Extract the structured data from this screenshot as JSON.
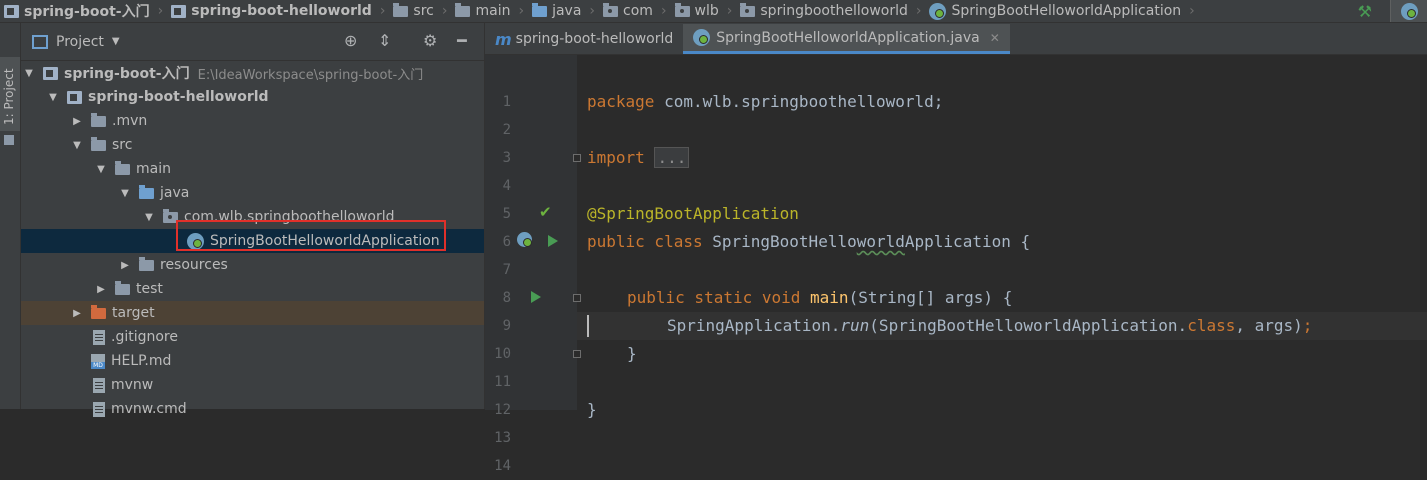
{
  "breadcrumbs": [
    "spring-boot-入门",
    "spring-boot-helloworld",
    "src",
    "main",
    "java",
    "com",
    "wlb",
    "springboothelloworld",
    "SpringBootHelloworldApplication"
  ],
  "side_tab": "1: Project",
  "project_panel": {
    "title": "Project",
    "tree": [
      {
        "label": "spring-boot-入门",
        "path": "E:\\IdeaWorkspace\\spring-boot-入门",
        "indent": 0,
        "state": "open",
        "icon": "module-icon",
        "bold": true
      },
      {
        "label": "spring-boot-helloworld",
        "path": "",
        "indent": 1,
        "state": "open",
        "icon": "module-icon",
        "bold": true
      },
      {
        "label": ".mvn",
        "path": "",
        "indent": 2,
        "state": "closed",
        "icon": "folder-icon"
      },
      {
        "label": "src",
        "path": "",
        "indent": 2,
        "state": "open",
        "icon": "folder-icon"
      },
      {
        "label": "main",
        "path": "",
        "indent": 3,
        "state": "open",
        "icon": "folder-icon"
      },
      {
        "label": "java",
        "path": "",
        "indent": 4,
        "state": "open",
        "icon": "source-folder-icon"
      },
      {
        "label": "com.wlb.springboothelloworld",
        "path": "",
        "indent": 5,
        "state": "open",
        "icon": "package-icon"
      },
      {
        "label": "SpringBootHelloworldApplication",
        "path": "",
        "indent": 6,
        "state": "none",
        "icon": "spring-class-icon",
        "selected": true
      },
      {
        "label": "resources",
        "path": "",
        "indent": 4,
        "state": "closed",
        "icon": "resources-folder-icon"
      },
      {
        "label": "test",
        "path": "",
        "indent": 3,
        "state": "closed",
        "icon": "folder-icon"
      },
      {
        "label": "target",
        "path": "",
        "indent": 2,
        "state": "closed",
        "icon": "excluded-folder-icon",
        "excluded": true
      },
      {
        "label": ".gitignore",
        "path": "",
        "indent": 2,
        "state": "none",
        "icon": "file-icon"
      },
      {
        "label": "HELP.md",
        "path": "",
        "indent": 2,
        "state": "none",
        "icon": "markdown-file-icon"
      },
      {
        "label": "mvnw",
        "path": "",
        "indent": 2,
        "state": "none",
        "icon": "file-icon"
      },
      {
        "label": "mvnw.cmd",
        "path": "",
        "indent": 2,
        "state": "none",
        "icon": "file-icon"
      }
    ]
  },
  "editor": {
    "tabs": [
      {
        "label": "spring-boot-helloworld",
        "active": false,
        "icon": "maven-icon"
      },
      {
        "label": "SpringBootHelloworldApplication.java",
        "active": true,
        "icon": "spring-class-icon"
      }
    ],
    "line_numbers": [
      "1",
      "2",
      "3",
      "4",
      "5",
      "6",
      "7",
      "8",
      "9",
      "10",
      "11",
      "12",
      "13",
      "14"
    ],
    "code": {
      "l1_kw": "package",
      "l1_rest": " com.wlb.springboothelloworld;",
      "l3_kw": "import",
      "l3_fold": "...",
      "l6_ann": "@SpringBootApplication",
      "l7_kw": "public class",
      "l7_name_a": " SpringBootHello",
      "l7_name_b": "world",
      "l7_name_c": "Application {",
      "l9_kw": "public static void",
      "l9_fn": "main",
      "l9_rest": "(String[] args) {",
      "l10_a": "SpringApplication.",
      "l10_run": "run",
      "l10_b": "(SpringBootHelloworldApplication.",
      "l10_kw": "class",
      "l10_c": ", args)",
      "l10_semi": ";",
      "l11": "}",
      "l13": "}"
    }
  }
}
